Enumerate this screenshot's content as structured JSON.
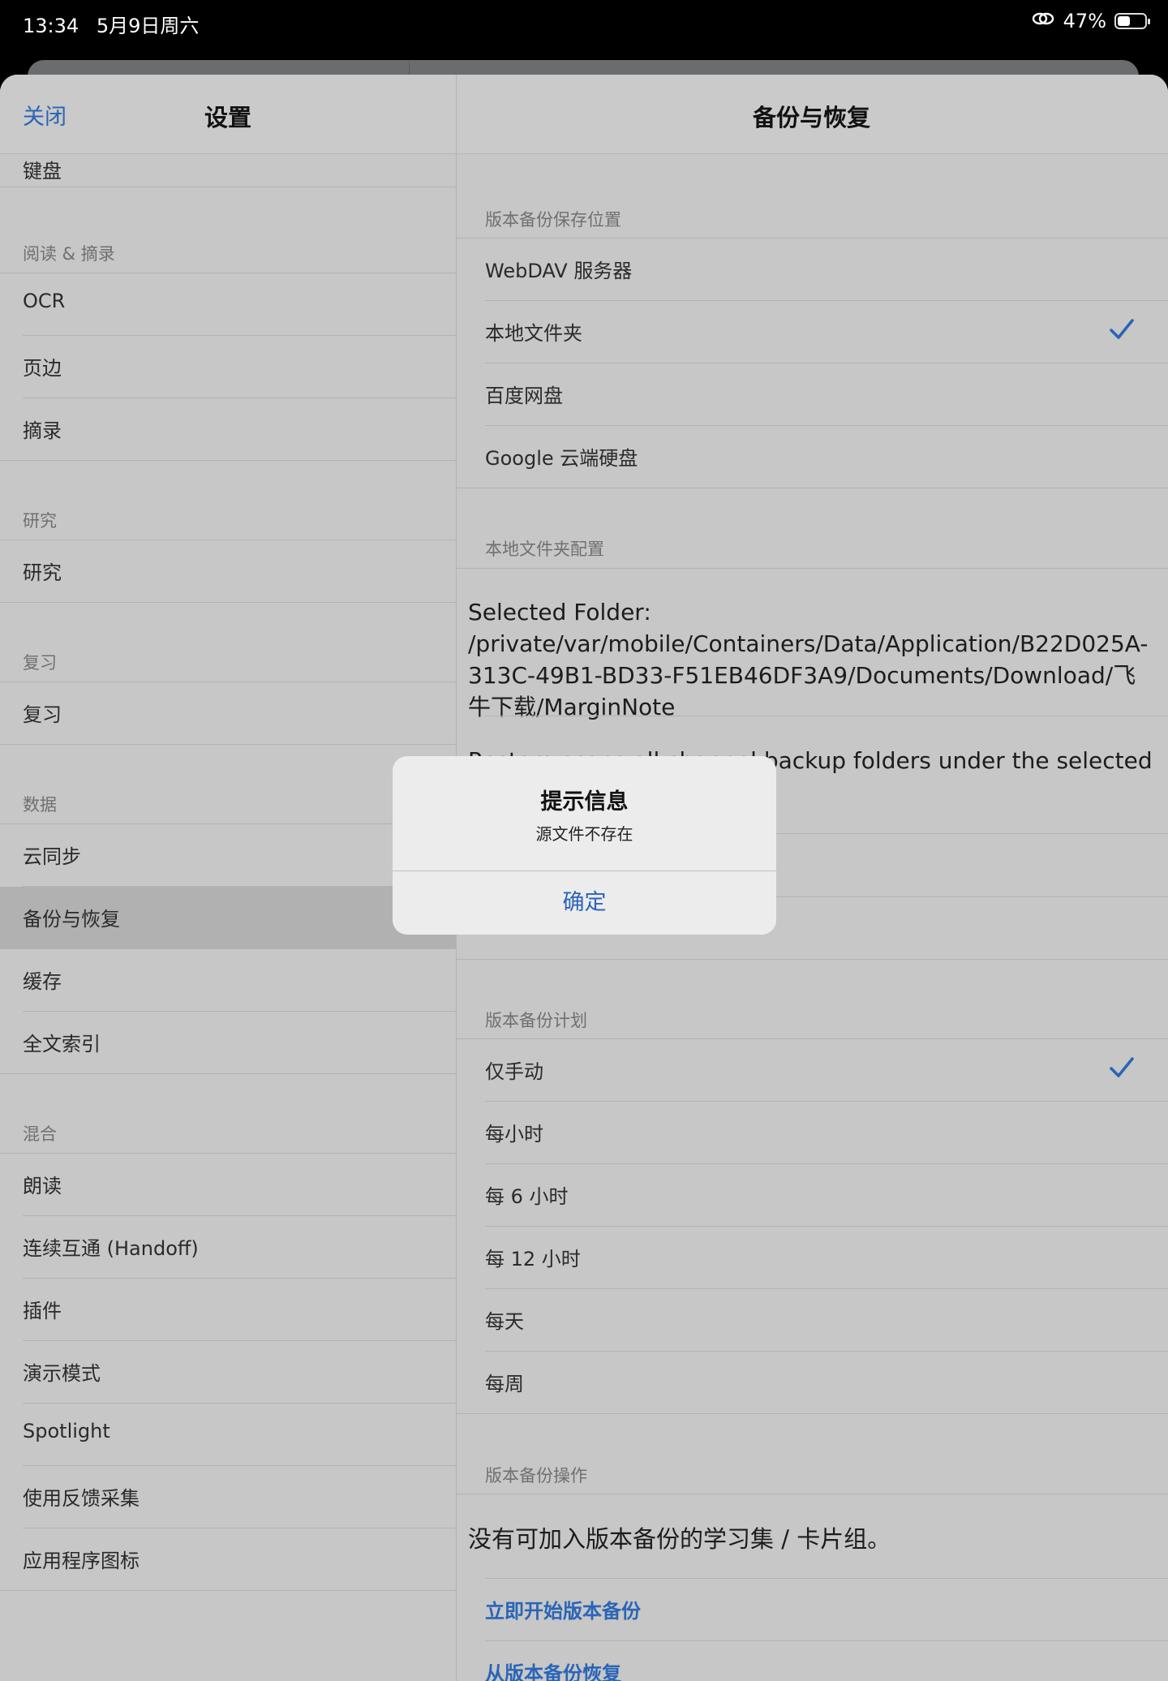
{
  "status_bar": {
    "time": "13:34",
    "date": "5月9日周六",
    "battery_text": "47%",
    "battery_level": 0.47
  },
  "left_panel": {
    "close_label": "关闭",
    "title": "设置",
    "top_item": "键盘",
    "sections": [
      {
        "header": "阅读 & 摘录",
        "items": [
          "OCR",
          "页边",
          "摘录"
        ]
      },
      {
        "header": "研究",
        "items": [
          "研究"
        ]
      },
      {
        "header": "复习",
        "items": [
          "复习"
        ]
      },
      {
        "header": "数据",
        "items": [
          "云同步",
          "备份与恢复",
          "缓存",
          "全文索引"
        ]
      },
      {
        "header": "混合",
        "items": [
          "朗读",
          "连续互通 (Handoff)",
          "插件",
          "演示模式",
          "Spotlight",
          "使用反馈采集",
          "应用程序图标"
        ]
      }
    ],
    "selected_item": "备份与恢复"
  },
  "right_panel": {
    "title": "备份与恢复",
    "location_header": "版本备份保存位置",
    "location_options": [
      "WebDAV 服务器",
      "本地文件夹",
      "百度网盘",
      "Google 云端硬盘"
    ],
    "location_selected": "本地文件夹",
    "local_header": "本地文件夹配置",
    "folder_text": "Selected Folder: /private/var/mobile/Containers/Data/Application/B22D025A-313C-49B1-BD33-F51EB46DF3A9/Documents/Download/飞牛下载/MarginNote",
    "restore_text": "Restore scans all channel backup folders under the selected",
    "plan_header": "版本备份计划",
    "plan_options": [
      "仅手动",
      "每小时",
      "每 6 小时",
      "每 12 小时",
      "每天",
      "每周"
    ],
    "plan_selected": "仅手动",
    "ops_header": "版本备份操作",
    "ops_text": "没有可加入版本备份的学习集 / 卡片组。",
    "ops_start": "立即开始版本备份",
    "ops_restore": "从版本备份恢复"
  },
  "alert": {
    "title": "提示信息",
    "message": "源文件不存在",
    "ok_label": "确定"
  },
  "colors": {
    "accent": "#2a64b8",
    "panel_bg": "#c6c7c6",
    "selected_row": "#b0b1b0",
    "alert_bg": "#ececec"
  }
}
